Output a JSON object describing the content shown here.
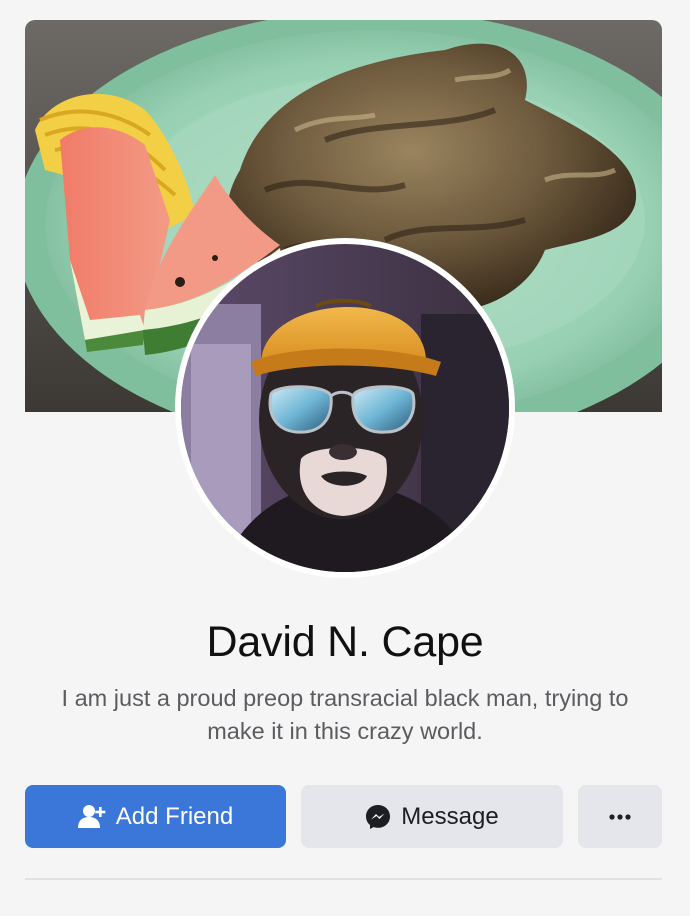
{
  "profile": {
    "name": "David N. Cape",
    "bio": "I am just a proud preop transracial black man, trying to make it in this crazy world."
  },
  "actions": {
    "add_friend_label": "Add Friend",
    "message_label": "Message",
    "more_label": "···"
  },
  "icons": {
    "add_friend": "add-friend-icon",
    "message": "messenger-icon",
    "more": "more-options-icon"
  },
  "colors": {
    "primary_button": "#3b77d8",
    "secondary_button": "#e4e6eb",
    "name_text": "#111111",
    "bio_text": "#5a5c60"
  }
}
